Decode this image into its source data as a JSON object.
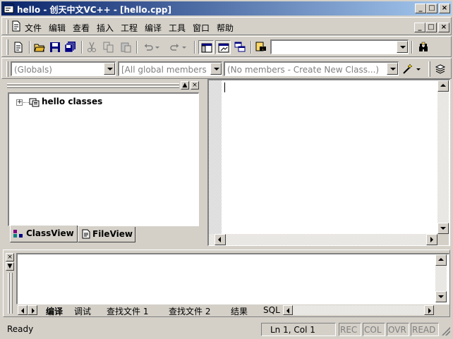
{
  "window": {
    "title": "hello - 创天中文VC++ - [hello.cpp]",
    "minimize": "_",
    "maximize": "□",
    "close": "×"
  },
  "menu": {
    "items": [
      "文件",
      "编辑",
      "查看",
      "插入",
      "工程",
      "编译",
      "工具",
      "窗口",
      "帮助"
    ]
  },
  "toolbar": {
    "find_combo_value": ""
  },
  "wizardbar": {
    "class_combo": "(Globals)",
    "filter_combo": "[All global members",
    "members_combo": "(No members - Create New Class...)"
  },
  "workspace": {
    "tree_root": "hello classes",
    "expand_glyph": "+",
    "tabs": [
      {
        "label": "ClassView",
        "active": true
      },
      {
        "label": "FileView",
        "active": false
      }
    ]
  },
  "output": {
    "tabs": [
      "编译",
      "调试",
      "查找文件 1",
      "查找文件 2",
      "结果",
      "SQL"
    ]
  },
  "status": {
    "message": "Ready",
    "position": "Ln 1, Col 1",
    "indicators": [
      "REC",
      "COL",
      "OVR",
      "READ"
    ]
  },
  "colors": {
    "title_start": "#0a246a",
    "title_end": "#a6caf0",
    "face": "#d4d0c8"
  }
}
